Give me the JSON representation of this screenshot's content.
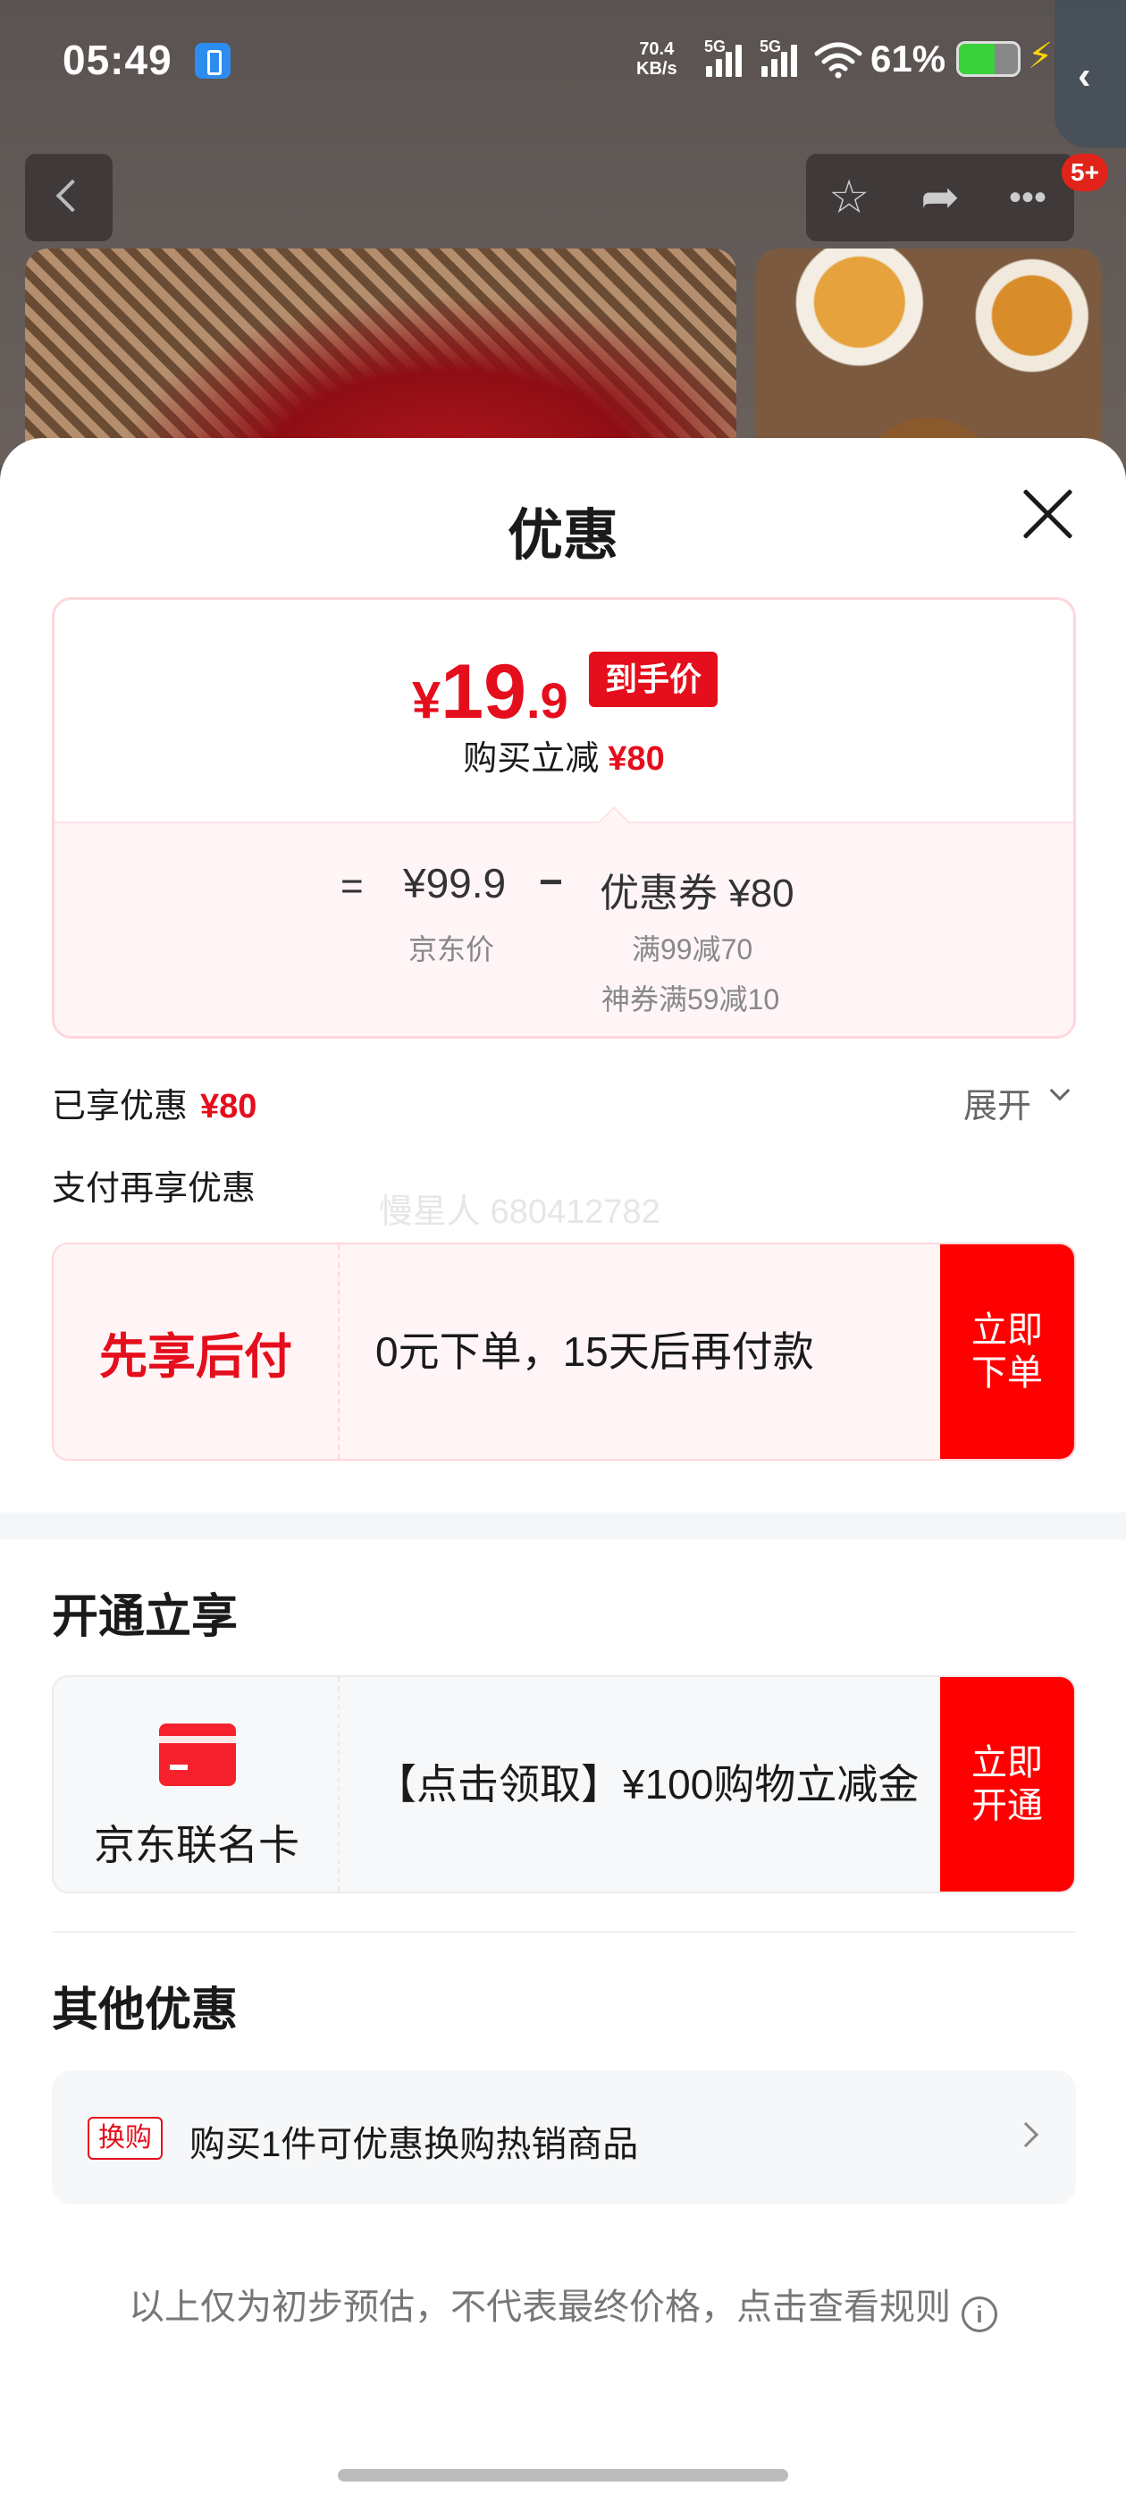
{
  "status_bar": {
    "time": "05:49",
    "net_speed_value": "70.4",
    "net_speed_unit": "KB/s",
    "signal1_label": "5G",
    "signal2_label": "5G",
    "battery_percent": "61%",
    "battery_level": 0.61
  },
  "nav": {
    "back_icon": "chevron-left-icon",
    "star_icon": "star",
    "share_icon": "share",
    "more_icon": "more",
    "badge": "5+"
  },
  "sheet": {
    "title": "优惠",
    "price_card": {
      "final_yen": "¥",
      "final_int": "19",
      "final_dec": ".9",
      "final_tag": "到手价",
      "save_label": "购买立减",
      "save_amount": "¥80",
      "calc_eq": "=",
      "original_price": "¥99.9",
      "calc_minus": "−",
      "coupon_line": "优惠券 ¥80",
      "original_label": "京东价",
      "coupon_detail_1": "满99减70",
      "coupon_detail_2": "神券满59减10"
    },
    "enjoyed_label": "已享优惠",
    "enjoyed_amount": "¥80",
    "expand_label": "展开",
    "pay_more_label": "支付再享优惠",
    "watermark": "慢星人 680412782",
    "bnpl": {
      "title": "先享后付",
      "desc": "0元下单，15天后再付款",
      "cta": "立即下单"
    },
    "open_section_title": "开通立享",
    "card_offer": {
      "label": "京东联名卡",
      "desc": "【点击领取】¥100购物立减金",
      "cta": "立即开通"
    },
    "other_section_title": "其他优惠",
    "swap": {
      "tag": "换购",
      "text": "购买1件可优惠换购热销商品"
    },
    "disclaimer": "以上仅为初步预估，不代表最终价格，点击查看规则"
  }
}
